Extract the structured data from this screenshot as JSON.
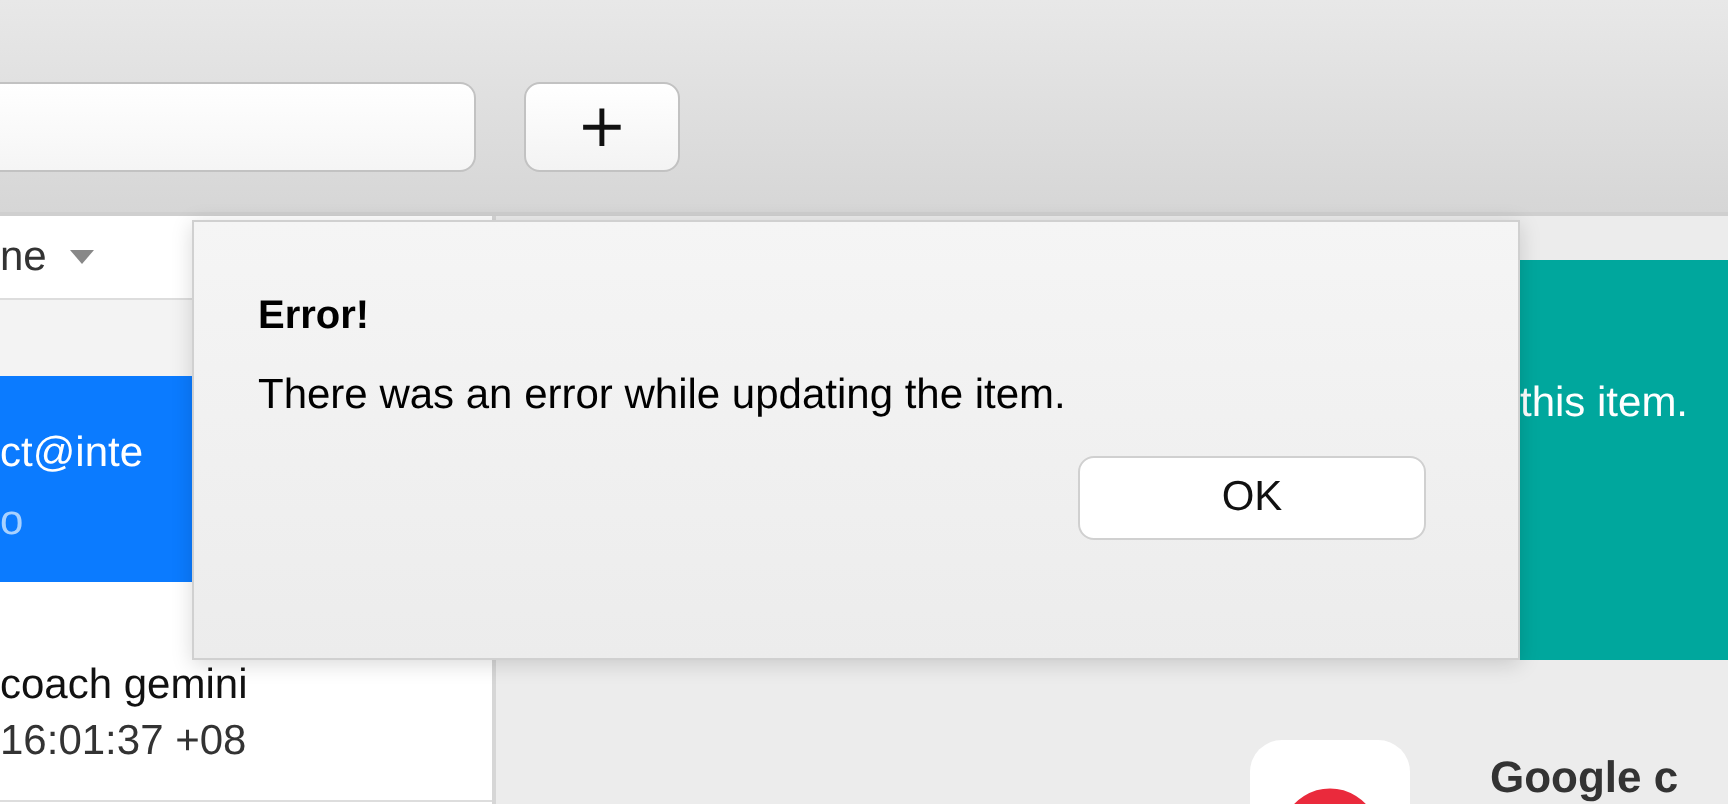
{
  "toolbar": {
    "add_button": {
      "label": "+"
    }
  },
  "list": {
    "column_header": {
      "label": "ne"
    },
    "items": [
      {
        "title": "ct@inte",
        "subtitle": "o",
        "selected": true
      },
      {
        "title": "coach gemini",
        "subtitle": "16:01:37 +08",
        "selected": false
      }
    ]
  },
  "banner": {
    "text": "this item."
  },
  "card": {
    "title": "Google c"
  },
  "dialog": {
    "title": "Error!",
    "message": "There was an error while updating the item.",
    "buttons": [
      "OK"
    ]
  }
}
